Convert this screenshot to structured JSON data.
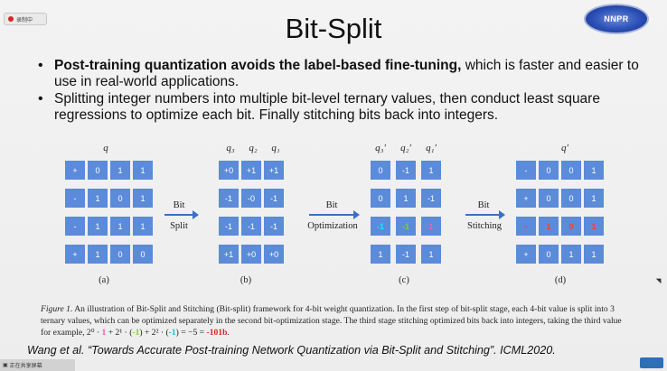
{
  "recording": {
    "label": "录制中"
  },
  "logo": {
    "text": "NNPR"
  },
  "title": "Bit-Split",
  "bullets": {
    "b1_bold": "Post-training quantization avoids the label-based fine-tuning,",
    "b1_rest": " which is faster and easier to use in real-world applications.",
    "b2": "Splitting integer numbers into multiple bit-level ternary values, then conduct least square regressions to optimize each bit. Finally stitching bits back into integers."
  },
  "figure": {
    "a": {
      "header": "q",
      "label": "(a)",
      "rows": [
        [
          "+",
          "0",
          "1",
          "1"
        ],
        [
          "-",
          "1",
          "0",
          "1"
        ],
        [
          "-",
          "1",
          "1",
          "1"
        ],
        [
          "+",
          "1",
          "0",
          "0"
        ]
      ]
    },
    "b": {
      "headers": [
        "q₃",
        "q₂",
        "q₁"
      ],
      "label": "(b)",
      "rows": [
        [
          "+0",
          "+1",
          "+1"
        ],
        [
          "-1",
          "-0",
          "-1"
        ],
        [
          "-1",
          "-1",
          "-1"
        ],
        [
          "+1",
          "+0",
          "+0"
        ]
      ]
    },
    "c": {
      "headers": [
        "q₃′",
        "q₂′",
        "q₁′"
      ],
      "label": "(c)",
      "rows": [
        [
          "0",
          "-1",
          "1"
        ],
        [
          "0",
          "1",
          "-1"
        ],
        [
          "-1",
          "-1",
          "1"
        ],
        [
          "1",
          "-1",
          "1"
        ]
      ]
    },
    "d": {
      "header": "q′",
      "label": "(d)",
      "rows": [
        [
          "-",
          "0",
          "0",
          "1"
        ],
        [
          "+",
          "0",
          "0",
          "1"
        ],
        [
          "-",
          "1",
          "0",
          "1"
        ],
        [
          "+",
          "0",
          "1",
          "1"
        ]
      ]
    },
    "arrows": [
      {
        "top": "Bit",
        "bottom": "Split"
      },
      {
        "top": "Bit",
        "bottom": "Optimization"
      },
      {
        "top": "Bit",
        "bottom": "Stitching"
      }
    ]
  },
  "caption": {
    "fig": "Figure 1.",
    "text1": " An illustration of Bit-Split and Stitching (Bit-split) framework for 4-bit weight quantization. In the first step of bit-split stage, each 4-bit value is split into 3 ternary values, which can be optimized separately in the second bit-optimization stage. The third stage stitching optimized bits back into integers, taking the third value for example, ",
    "formula_a": "2⁰ · ",
    "v1": "1",
    "formula_b": " + 2¹ · (",
    "v2": "-1",
    "formula_c": ") + 2² · (",
    "v3": "-1",
    "formula_d": ") = −5 = ",
    "result": "-101b",
    "end": "."
  },
  "citation": "Wang et al. “Towards Accurate Post-training Network Quantization via Bit-Split and Stitching”. ICML2020.",
  "share_bar": {
    "label": "正在共享屏幕"
  },
  "colors": {
    "cell": "#5b8bd9",
    "arrow": "#3b6fc9",
    "pink": "#ff5aa0",
    "green": "#7ed321",
    "cyan": "#20e0ff",
    "red": "#e02020"
  }
}
